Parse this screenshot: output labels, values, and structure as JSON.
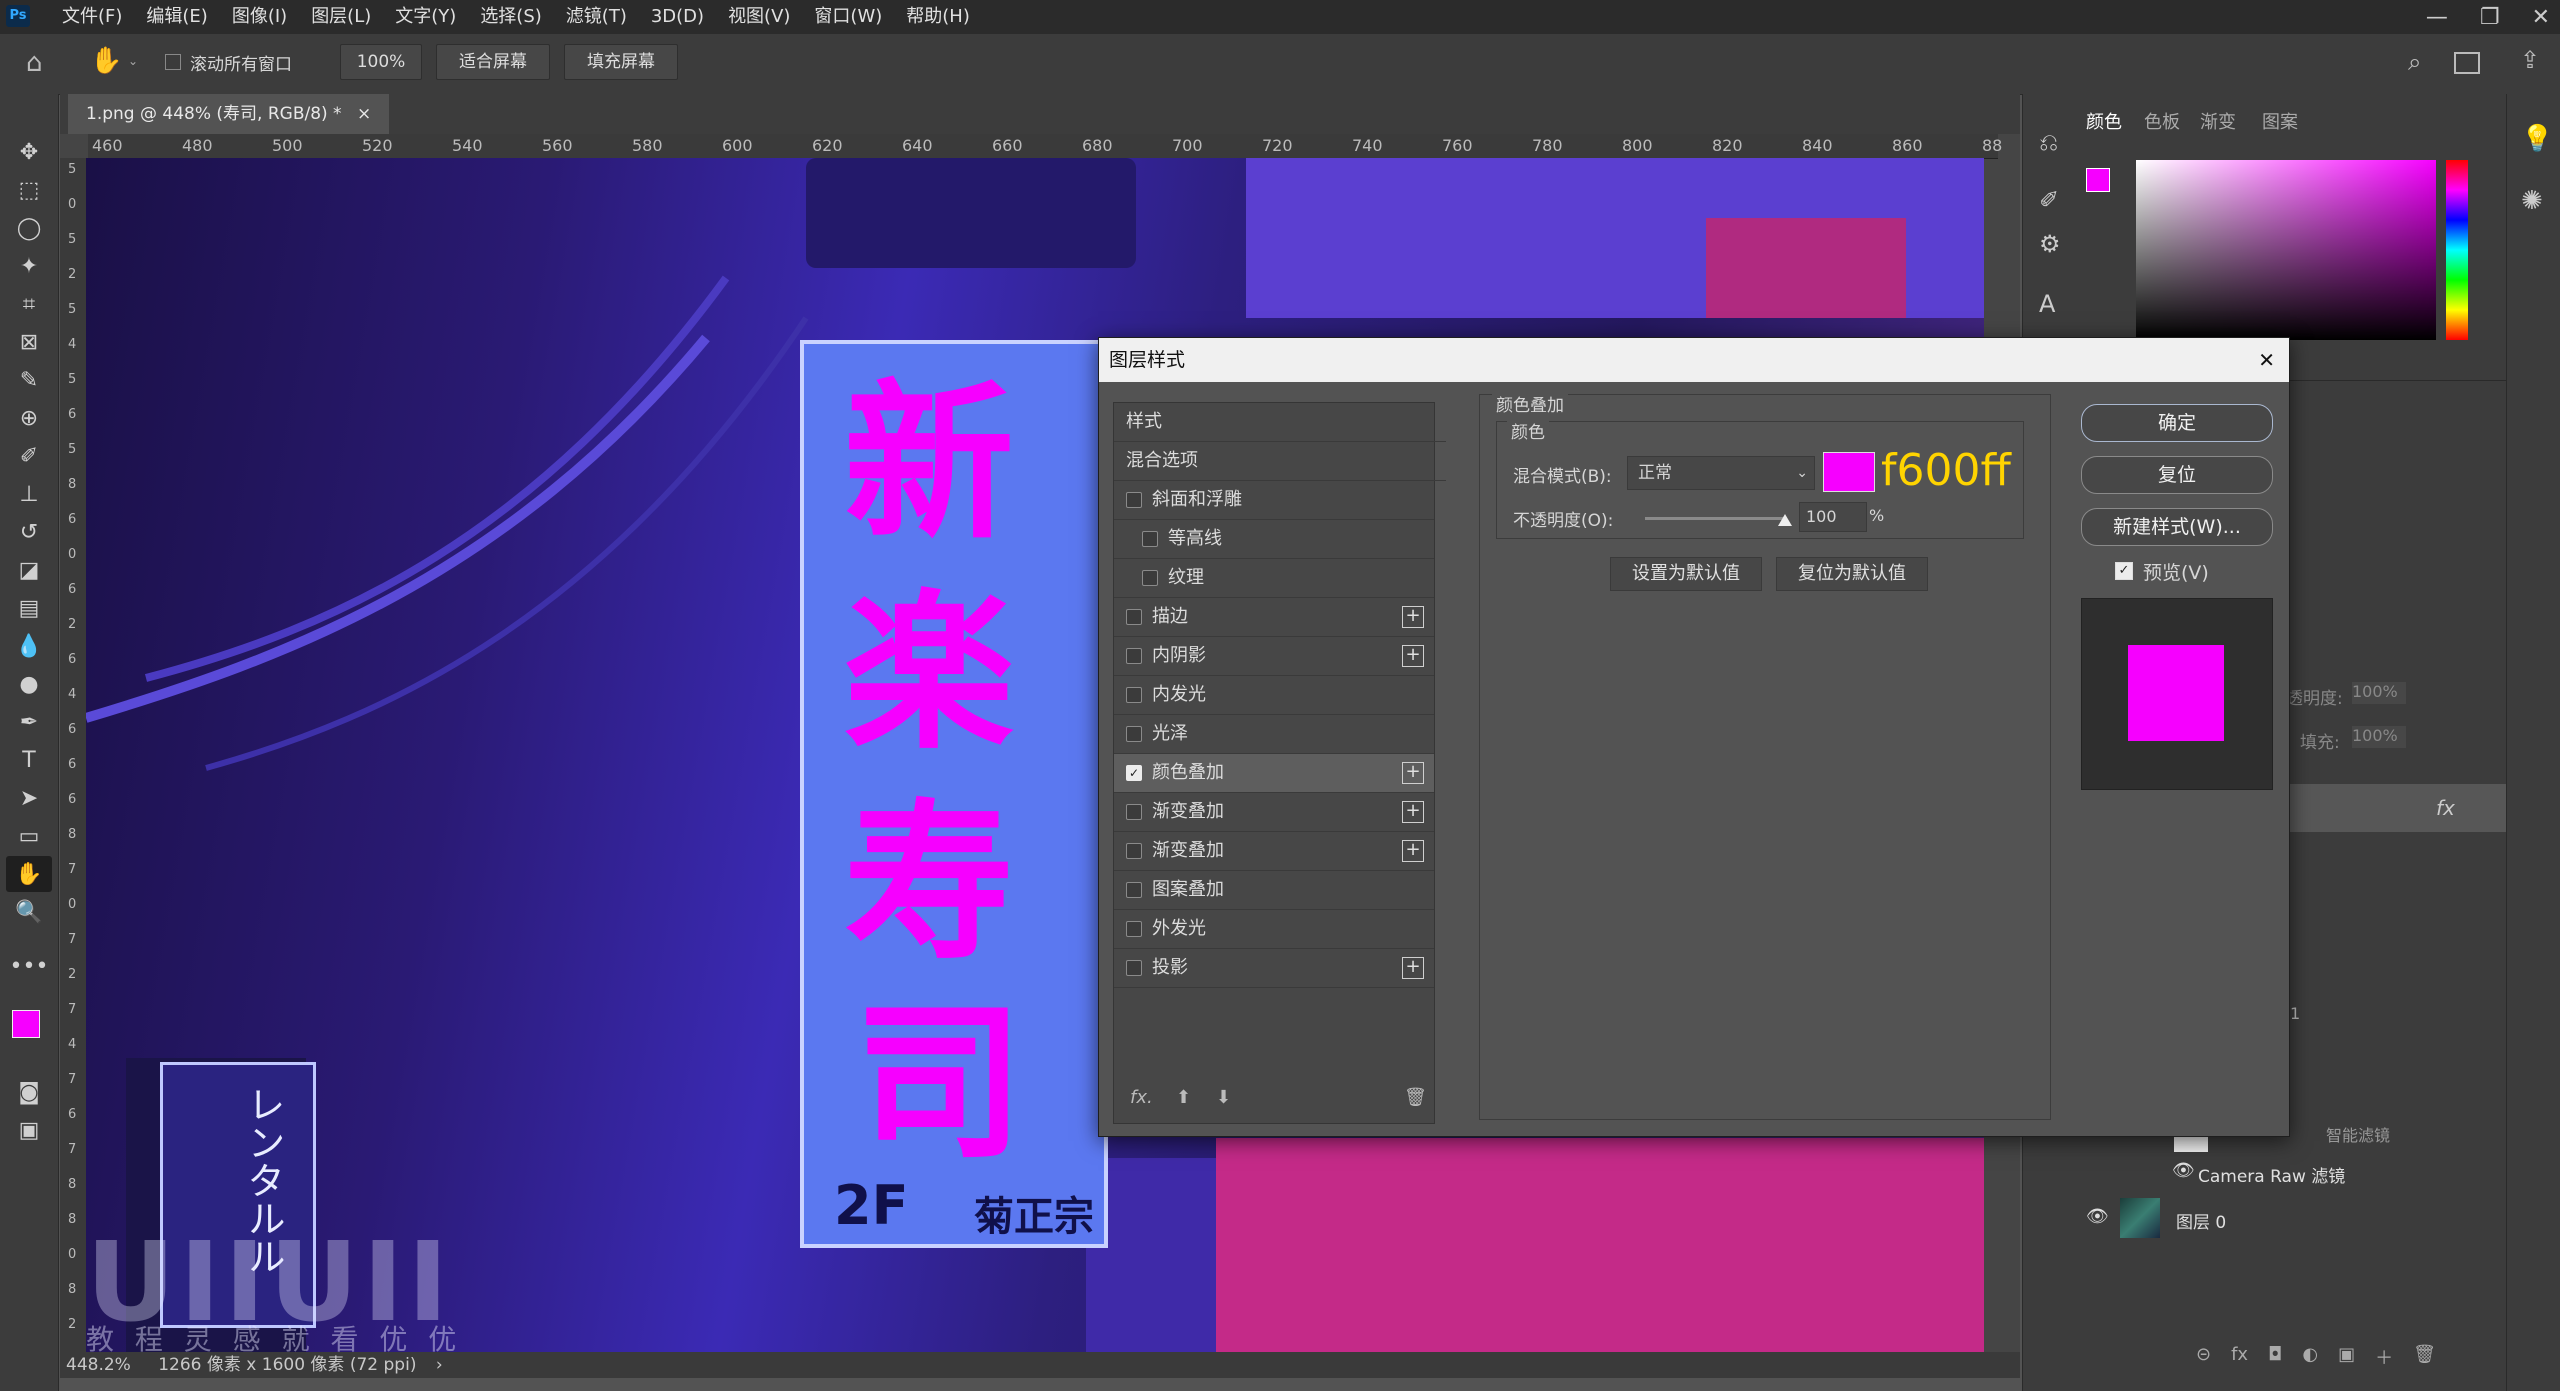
{
  "app": {
    "logo": "Ps"
  },
  "menu": [
    "文件(F)",
    "编辑(E)",
    "图像(I)",
    "图层(L)",
    "文字(Y)",
    "选择(S)",
    "滤镜(T)",
    "3D(D)",
    "视图(V)",
    "窗口(W)",
    "帮助(H)"
  ],
  "window_controls": [
    "—",
    "❐",
    "✕"
  ],
  "options": {
    "scroll_all": "滚动所有窗口",
    "zoom": "100%",
    "fit": "适合屏幕",
    "fill": "填充屏幕"
  },
  "document": {
    "tab": "1.png @ 448% (寿司, RGB/8) *",
    "close": "×"
  },
  "ruler_h": [
    "460",
    "480",
    "500",
    "520",
    "540",
    "560",
    "580",
    "600",
    "620",
    "640",
    "660",
    "680",
    "700",
    "720",
    "740",
    "760",
    "780",
    "800",
    "820",
    "840",
    "860",
    "88"
  ],
  "ruler_v": [
    "5",
    "0",
    "5",
    "2",
    "5",
    "4",
    "5",
    "6",
    "5",
    "8",
    "6",
    "0",
    "6",
    "2",
    "6",
    "4",
    "6",
    "6",
    "6",
    "8",
    "7",
    "0",
    "7",
    "2",
    "7",
    "4",
    "7",
    "6",
    "7",
    "8",
    "8",
    "0",
    "8",
    "2"
  ],
  "photo": {
    "sign_chars": [
      "新",
      "楽",
      "寿",
      "司"
    ],
    "sign_bottom_left": "2F",
    "sign_bottom_right": "菊正宗",
    "small_sign": "レンタルル",
    "watermark_logo": "UIIUII",
    "watermark_text": "教 程 灵 感 就 看 优 优"
  },
  "status": {
    "zoom": "448.2%",
    "info": "1266 像素 x 1600 像素 (72 ppi)",
    "arrow": "›"
  },
  "color_panel": {
    "tabs": [
      "颜色",
      "色板",
      "渐变",
      "图案"
    ]
  },
  "layers_panel": {
    "opacity_label": "透明度:",
    "opacity_value": "100%",
    "fill_label": "填充:",
    "fill_value": "100%",
    "fx": "fx",
    "num": "1",
    "smart_filter": "智能滤镜",
    "camera_raw": "Camera Raw 滤镜",
    "layer0": "图层 0",
    "bottom_icons": [
      "⊝",
      "fx",
      "◘",
      "◐",
      "▣",
      "＋",
      "🗑"
    ]
  },
  "dialog": {
    "title": "图层样式",
    "close": "✕",
    "style_header": "样式",
    "blend_options": "混合选项",
    "styles": [
      {
        "label": "斜面和浮雕",
        "checked": false,
        "plus": false,
        "indent": false
      },
      {
        "label": "等高线",
        "checked": false,
        "plus": false,
        "indent": true
      },
      {
        "label": "纹理",
        "checked": false,
        "plus": false,
        "indent": true
      },
      {
        "label": "描边",
        "checked": false,
        "plus": true,
        "indent": false
      },
      {
        "label": "内阴影",
        "checked": false,
        "plus": true,
        "indent": false
      },
      {
        "label": "内发光",
        "checked": false,
        "plus": false,
        "indent": false
      },
      {
        "label": "光泽",
        "checked": false,
        "plus": false,
        "indent": false
      },
      {
        "label": "颜色叠加",
        "checked": true,
        "plus": true,
        "indent": false
      },
      {
        "label": "渐变叠加",
        "checked": false,
        "plus": true,
        "indent": false
      },
      {
        "label": "渐变叠加",
        "checked": false,
        "plus": true,
        "indent": false
      },
      {
        "label": "图案叠加",
        "checked": false,
        "plus": false,
        "indent": false
      },
      {
        "label": "外发光",
        "checked": false,
        "plus": false,
        "indent": false
      },
      {
        "label": "投影",
        "checked": false,
        "plus": true,
        "indent": false
      }
    ],
    "footer_icons": [
      "fx.",
      "⬆",
      "⬇",
      "🗑"
    ],
    "section_title": "颜色叠加",
    "sub_title": "颜色",
    "blend_mode_label": "混合模式(B):",
    "blend_mode_value": "正常",
    "color_hex_annotation": "f600ff",
    "opacity_label": "不透明度(O):",
    "opacity_value": "100",
    "opacity_unit": "%",
    "opacity_level": 1.0,
    "set_default": "设置为默认值",
    "reset_default": "复位为默认值",
    "ok": "确定",
    "reset": "复位",
    "new_style": "新建样式(W)...",
    "preview_label": "预览(V)",
    "preview_checked": true
  },
  "colors": {
    "overlay": "#f600ff",
    "fg": "#f600ff",
    "bg": "#f5d000",
    "annotation": "#ffd400"
  }
}
